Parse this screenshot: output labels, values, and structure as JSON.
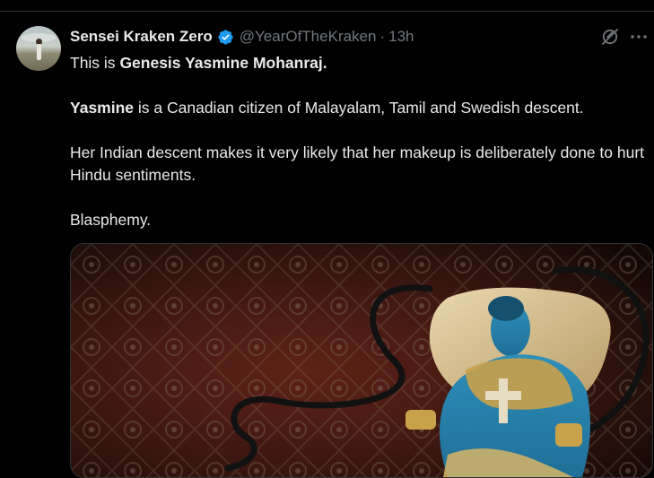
{
  "tweet": {
    "author": {
      "display_name": "Sensei Kraken Zero",
      "handle": "@YearOfTheKraken",
      "verified": true
    },
    "separator": "·",
    "timestamp": "13h",
    "body": {
      "line1_prefix": "This is ",
      "line1_bold": "Genesis Yasmine Mohanraj.",
      "line2_bold": "Yasmine",
      "line2_rest": " is a Canadian citizen of Malayalam, Tamil and Swedish descent.",
      "line3": "Her Indian descent makes it very likely that her makeup is deliberately done to hurt Hindu sentiments.",
      "line4": "Blasphemy."
    },
    "media": {
      "kind": "image",
      "icon": "photo"
    },
    "actions": {
      "grok_icon": "grok-icon",
      "more_icon": "more-icon"
    }
  },
  "colors": {
    "background": "#000000",
    "text_primary": "#e7e9ea",
    "text_secondary": "#71767b",
    "verified_blue": "#1d9bf0",
    "divider": "#2f3336"
  }
}
